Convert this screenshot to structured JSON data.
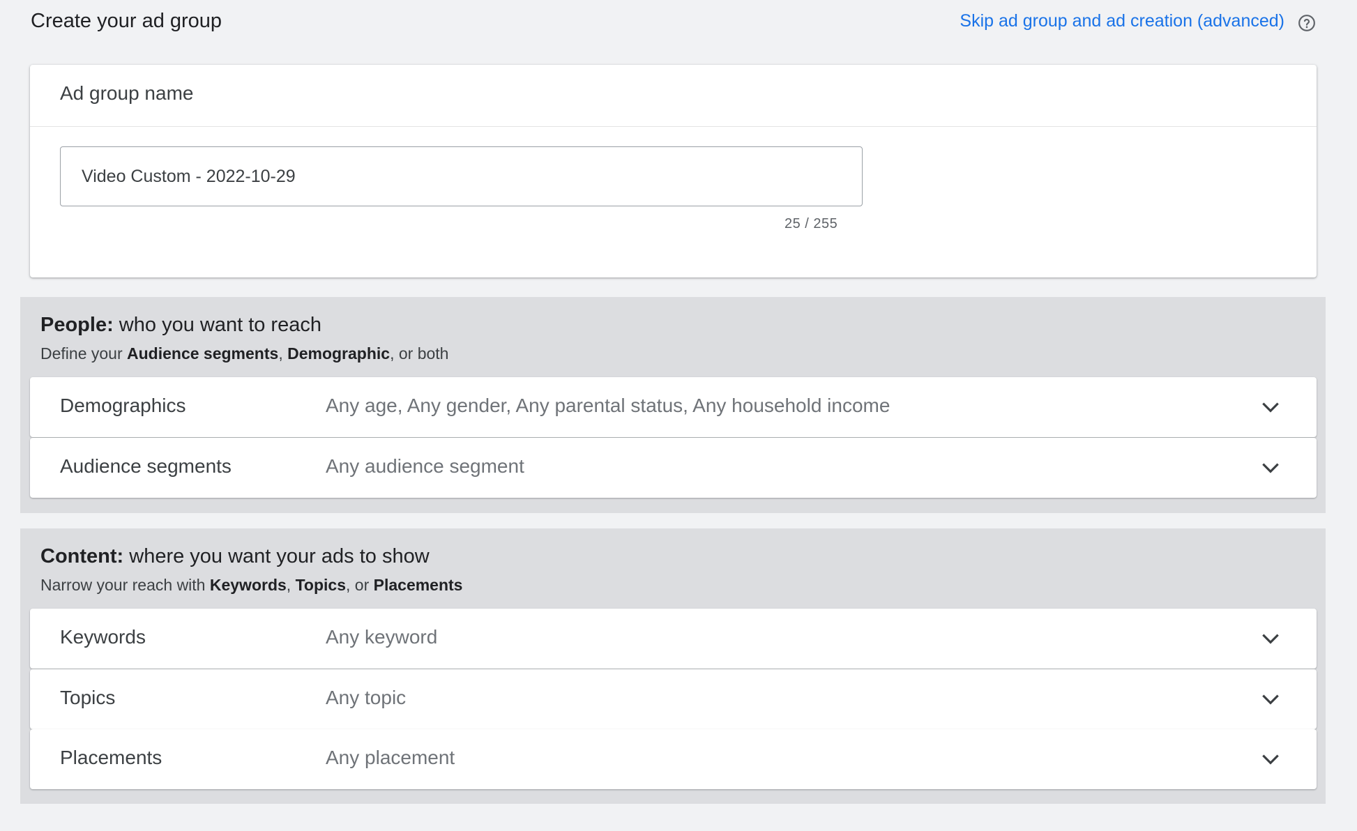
{
  "header": {
    "title": "Create your ad group",
    "skip_link": "Skip ad group and ad creation (advanced)"
  },
  "ad_group_card": {
    "title": "Ad group name",
    "input_value": "Video Custom - 2022-10-29",
    "counter": "25 / 255"
  },
  "people": {
    "heading_bold": "People:",
    "heading_rest": " who you want to reach",
    "sub_pre": "Define your ",
    "sub_b1": "Audience segments",
    "sub_mid": ", ",
    "sub_b2": "Demographic",
    "sub_post": ", or both",
    "rows": [
      {
        "label": "Demographics",
        "value": "Any age, Any gender, Any parental status, Any household income"
      },
      {
        "label": "Audience segments",
        "value": "Any audience segment"
      }
    ]
  },
  "content": {
    "heading_bold": "Content:",
    "heading_rest": " where you want your ads to show",
    "sub_pre": "Narrow your reach with ",
    "sub_b1": "Keywords",
    "sub_mid1": ", ",
    "sub_b2": "Topics",
    "sub_mid2": ", or ",
    "sub_b3": "Placements",
    "rows": [
      {
        "label": "Keywords",
        "value": "Any keyword"
      },
      {
        "label": "Topics",
        "value": "Any topic"
      },
      {
        "label": "Placements",
        "value": "Any placement"
      }
    ]
  },
  "icons": {
    "help": "help-circle-icon",
    "expand": "chevron-down-icon"
  },
  "colors": {
    "link": "#1a73e8",
    "page_bg": "#f1f2f4",
    "section_bg": "#dcdde0"
  }
}
